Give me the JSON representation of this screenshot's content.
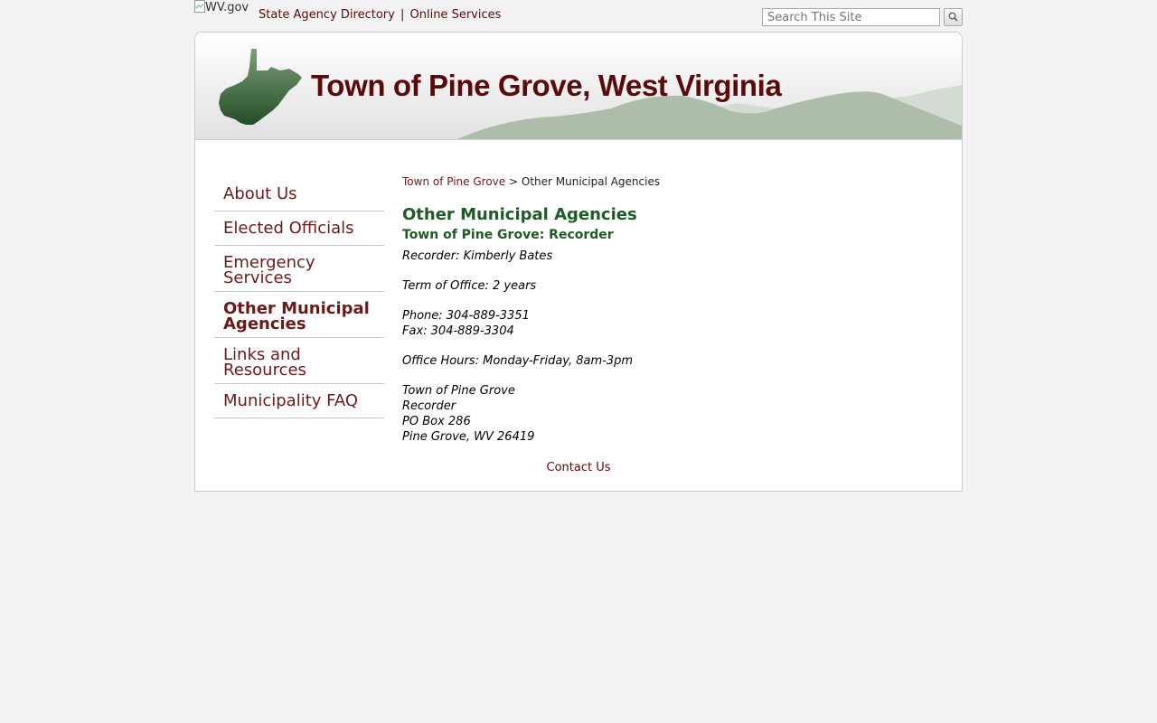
{
  "topbar": {
    "logo_alt": "WV.gov",
    "links": [
      {
        "label": "State Agency Directory"
      },
      {
        "label": "Online Services"
      }
    ],
    "separator": "|",
    "search": {
      "placeholder": "Search This Site"
    }
  },
  "banner": {
    "title": "Town of Pine Grove, West Virginia"
  },
  "sidebar": {
    "items": [
      {
        "label": "About Us"
      },
      {
        "label": "Elected Officials"
      },
      {
        "label": "Emergency Services"
      },
      {
        "label": "Other Municipal Agencies",
        "active": true
      },
      {
        "label": "Links and Resources"
      },
      {
        "label": "Municipality FAQ"
      }
    ]
  },
  "breadcrumb": {
    "home": "Town of Pine Grove",
    "separator": ">",
    "current": "Other Municipal Agencies"
  },
  "main": {
    "title": "Other Municipal Agencies",
    "subtitle": "Town of Pine Grove: Recorder",
    "recorder": "Recorder: Kimberly Bates",
    "term": "Term of Office: 2 years",
    "phone": "Phone: 304-889-3351",
    "fax": "Fax: 304-889-3304",
    "hours": "Office Hours: Monday-Friday, 8am-3pm",
    "address": [
      "Town of Pine Grove",
      "Recorder",
      "PO Box 286",
      "Pine Grove, WV 26419"
    ]
  },
  "footer": {
    "contact_label": "Contact Us"
  },
  "colors": {
    "link": "#5a0a0a",
    "heading_green": "#1e5b27",
    "background": "#f2f2f2"
  }
}
